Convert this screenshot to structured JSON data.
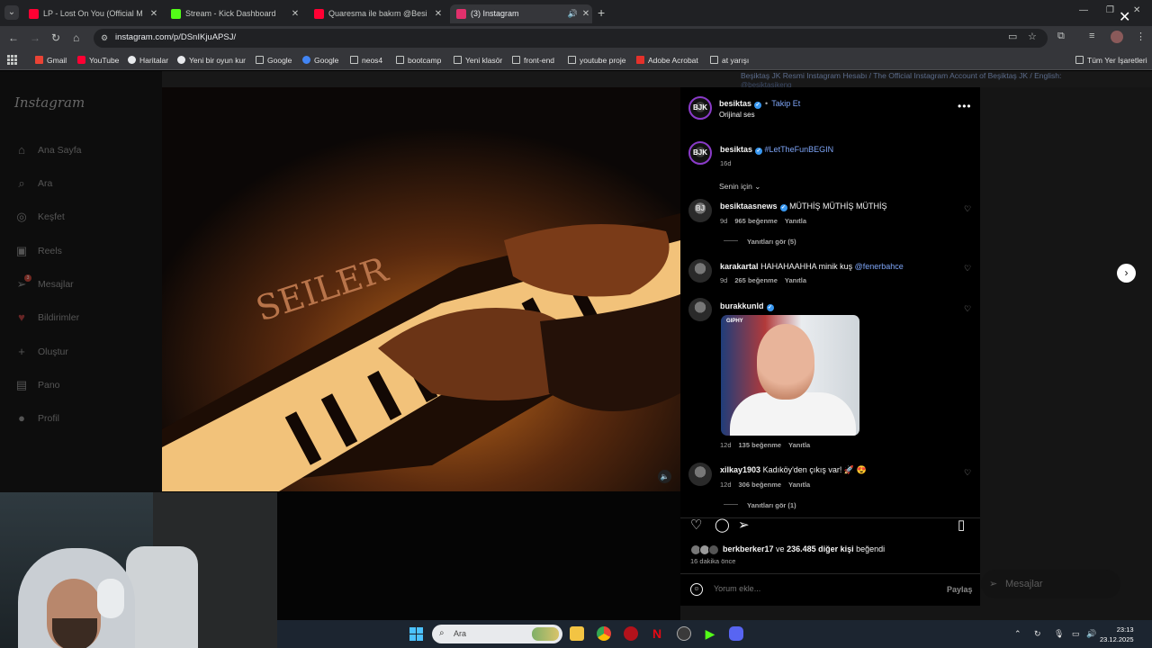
{
  "browser": {
    "tabs": [
      {
        "title": "LP - Lost On You (Official Music",
        "icon_color": "#ff0033",
        "active": false
      },
      {
        "title": "Stream - Kick Dashboard",
        "icon_color": "#53fc18",
        "active": false
      },
      {
        "title": "Quaresma ile bakım @Besiktas",
        "icon_color": "#ff0033",
        "active": false
      },
      {
        "title": "(3) Instagram",
        "icon_color": "#e1306c",
        "active": true
      }
    ],
    "url": "instagram.com/p/DSnIKjuAPSJ/",
    "bookmarks": [
      {
        "label": "Gmail",
        "icon": "gmail-icon"
      },
      {
        "label": "YouTube",
        "icon": "youtube-icon"
      },
      {
        "label": "Haritalar",
        "icon": "maps-icon"
      },
      {
        "label": "Yeni bir oyun kur",
        "icon": "chess-icon"
      },
      {
        "label": "Google",
        "icon": "folder-icon"
      },
      {
        "label": "Google",
        "icon": "google-icon"
      },
      {
        "label": "neos4",
        "icon": "folder-icon"
      },
      {
        "label": "bootcamp",
        "icon": "folder-icon"
      },
      {
        "label": "Yeni klasör",
        "icon": "folder-icon"
      },
      {
        "label": "front-end",
        "icon": "folder-icon"
      },
      {
        "label": "youtube proje",
        "icon": "folder-icon"
      },
      {
        "label": "Adobe Acrobat",
        "icon": "acrobat-icon"
      },
      {
        "label": "at yarışı",
        "icon": "folder-icon"
      }
    ],
    "all_bookmarks": "Tüm Yer İşaretleri"
  },
  "instagram": {
    "logo": "Instagram",
    "nav": [
      {
        "label": "Ana Sayfa",
        "icon": "home-icon"
      },
      {
        "label": "Ara",
        "icon": "search-icon"
      },
      {
        "label": "Keşfet",
        "icon": "explore-icon"
      },
      {
        "label": "Reels",
        "icon": "reels-icon"
      },
      {
        "label": "Mesajlar",
        "icon": "messages-icon",
        "badge": "3"
      },
      {
        "label": "Bildirimler",
        "icon": "heart-icon"
      },
      {
        "label": "Oluştur",
        "icon": "plus-icon"
      },
      {
        "label": "Pano",
        "icon": "dashboard-icon"
      },
      {
        "label": "Profil",
        "icon": "profile-icon"
      }
    ],
    "bg_text": "Beşiktaş JK Resmi Instagram Hesabı / The Official Instagram Account of Beşiktaş JK / English:",
    "bg_handle": "@besiktasjkeng",
    "post": {
      "author": "besiktas",
      "follow_label": "Takip Et",
      "audio": "Orijinal ses",
      "caption_author": "besiktas",
      "caption": "#LetTheFunBEGIN",
      "caption_time": "16d",
      "sort_label": "Senin için"
    },
    "comments": [
      {
        "user": "besiktaasnews",
        "verified": true,
        "text": "MÜTHİŞ MÜTHİŞ MÜTHİŞ",
        "time": "9d",
        "likes": "965 beğenme",
        "reply": "Yanıtla",
        "replies": "Yanıtları gör (5)"
      },
      {
        "user": "karakartal",
        "verified": false,
        "text": "HAHAHAAHHA minik kuş",
        "mention": "@fenerbahce",
        "time": "9d",
        "likes": "265 beğenme",
        "reply": "Yanıtla"
      },
      {
        "user": "burakkunld",
        "verified": true,
        "time": "12d",
        "likes": "135 beğenme",
        "reply": "Yanıtla",
        "gif_tag": "GIPHY"
      },
      {
        "user": "xilkay1903",
        "verified": false,
        "text": "Kadıköy'den çıkış var! 🚀 😍",
        "time": "12d",
        "likes": "306 beğenme",
        "reply": "Yanıtla",
        "replies": "Yanıtları gör (1)"
      }
    ],
    "likes_user": "berkberker17",
    "likes_rest": " ve ",
    "likes_count": "236.485 diğer kişi",
    "likes_suffix": " beğendi",
    "time_ago": "16 dakika önce",
    "comment_placeholder": "Yorum ekle...",
    "share_label": "Paylaş",
    "dm_label": "Mesajlar",
    "video_brand": "SEILER"
  },
  "taskbar": {
    "search_label": "Ara",
    "time": "23:13",
    "date": "23.12.2025"
  }
}
